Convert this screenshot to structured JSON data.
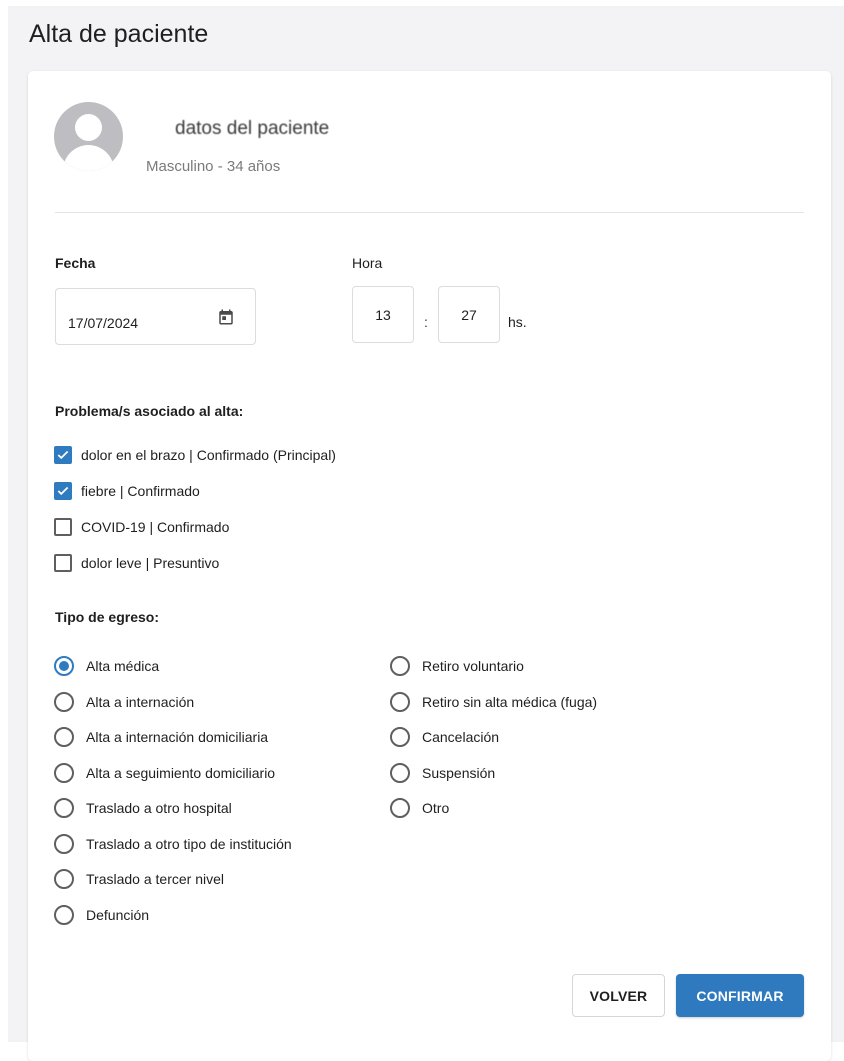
{
  "page": {
    "title": "Alta de paciente"
  },
  "patient": {
    "name": "datos del paciente",
    "info": "Masculino - 34 años"
  },
  "date_field": {
    "label": "Fecha",
    "value": "17/07/2024",
    "icon": "calendar-icon"
  },
  "time_field": {
    "label": "Hora",
    "hours": "13",
    "separator": ":",
    "minutes": "27",
    "suffix": "hs."
  },
  "problems": {
    "label": "Problema/s asociado al alta:",
    "items": [
      {
        "label": "dolor en el brazo | Confirmado (Principal)",
        "checked": true
      },
      {
        "label": "fiebre | Confirmado",
        "checked": true
      },
      {
        "label": "COVID-19 | Confirmado",
        "checked": false
      },
      {
        "label": "dolor leve | Presuntivo",
        "checked": false
      }
    ]
  },
  "discharge_type": {
    "label": "Tipo de egreso:",
    "selected": "Alta médica",
    "column1": [
      "Alta médica",
      "Alta a internación",
      "Alta a internación domiciliaria",
      "Alta a seguimiento domiciliario",
      "Traslado a otro hospital",
      "Traslado a otro tipo de institución",
      "Traslado a tercer nivel",
      "Defunción"
    ],
    "column2": [
      "Retiro voluntario",
      "Retiro sin alta médica (fuga)",
      "Cancelación",
      "Suspensión",
      "Otro"
    ]
  },
  "actions": {
    "back_label": "VOLVER",
    "confirm_label": "CONFIRMAR"
  },
  "colors": {
    "accent": "#2f7bc0",
    "page_background": "#f3f3f6"
  }
}
